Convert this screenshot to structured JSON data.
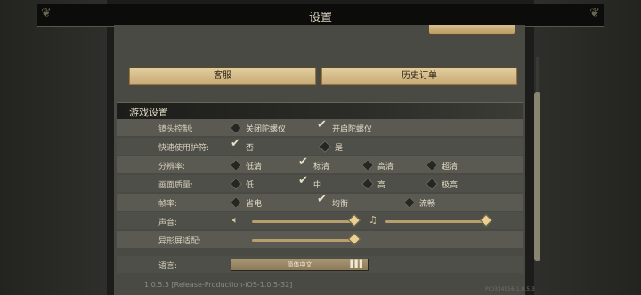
{
  "title": "设置",
  "buttons": {
    "top_tab": "",
    "customer_service": "客服",
    "order_history": "历史订单"
  },
  "section": {
    "title": "游戏设置"
  },
  "rows": {
    "camera": {
      "label": "镜头控制:",
      "options": [
        {
          "text": "关闭陀螺仪",
          "checked": false
        },
        {
          "text": "开启陀螺仪",
          "checked": true
        }
      ]
    },
    "charm": {
      "label": "快速使用护符:",
      "options": [
        {
          "text": "否",
          "checked": true
        },
        {
          "text": "是",
          "checked": false
        }
      ]
    },
    "resolution": {
      "label": "分辨率:",
      "options": [
        {
          "text": "低清",
          "checked": false
        },
        {
          "text": "标清",
          "checked": true
        },
        {
          "text": "高清",
          "checked": false
        },
        {
          "text": "超清",
          "checked": false
        }
      ]
    },
    "quality": {
      "label": "画面质量:",
      "options": [
        {
          "text": "低",
          "checked": false
        },
        {
          "text": "中",
          "checked": true
        },
        {
          "text": "高",
          "checked": false
        },
        {
          "text": "极高",
          "checked": false
        }
      ]
    },
    "fps": {
      "label": "帧率:",
      "options": [
        {
          "text": "省电",
          "checked": false
        },
        {
          "text": "均衡",
          "checked": true
        },
        {
          "text": "流畅",
          "checked": false
        }
      ]
    },
    "sound": {
      "label": "声音:",
      "sfx_level": 1.0,
      "music_level": 1.0
    },
    "notch": {
      "label": "异形屏适配:",
      "level": 1.0
    },
    "language": {
      "label": "语言:",
      "value": "简体中文"
    }
  },
  "version": "1.0.5.3 [Release-Production-iOS-1.0.5-32]",
  "build_id": "PID334956  1.0.5.3",
  "icons": {
    "check": "checkmark-icon",
    "option": "diamond-icon",
    "sfx": "speaker-icon",
    "music": "music-note-icon",
    "lang": "bars-icon"
  }
}
